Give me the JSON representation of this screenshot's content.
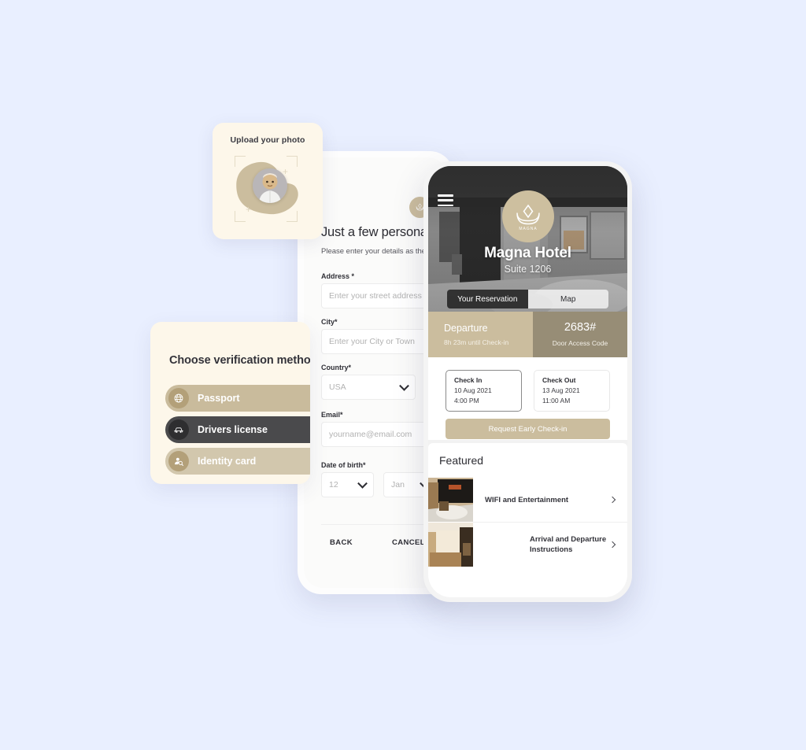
{
  "theme": {
    "page_background": "#e9efff",
    "accent_tan": "#cbbd9e",
    "accent_dark_tan": "#978d76",
    "card_cream": "#fdf7ea",
    "dark": "#4a4a4c"
  },
  "upload_card": {
    "title": "Upload your photo",
    "avatar_icon": "user-photo",
    "frame_icon": "focus-frame-icon"
  },
  "verification_card": {
    "title": "Choose verification method",
    "methods": [
      {
        "label": "Passport",
        "icon": "globe-icon",
        "state": "default"
      },
      {
        "label": "Drivers license",
        "icon": "car-icon",
        "state": "selected"
      },
      {
        "label": "Identity card",
        "icon": "id-person-search-icon",
        "state": "default"
      }
    ]
  },
  "form_phone": {
    "logo_icon": "magna-lotus-logo",
    "heading": "Just a few personal details",
    "subtitle": "Please enter your details as they appear",
    "fields": [
      {
        "label": "Address *",
        "placeholder": "Enter your street address",
        "type": "text"
      },
      {
        "label": "City*",
        "placeholder": "Enter your City or Town",
        "type": "text"
      },
      {
        "label": "Country*",
        "value": "USA",
        "type": "select"
      },
      {
        "label": "Email*",
        "placeholder": "yourname@email.com",
        "type": "text"
      }
    ],
    "dob": {
      "label": "Date of birth*",
      "day": "12",
      "month": "Jan"
    },
    "actions": {
      "back": "BACK",
      "cancel": "CANCEL"
    }
  },
  "hotel_phone": {
    "menu_icon": "hamburger-menu-icon",
    "logo": {
      "icon": "lotus-icon",
      "wordmark": "MAGNA"
    },
    "hotel_name": "Magna Hotel",
    "suite": "Suite 1206",
    "tabs": [
      {
        "label": "Your Reservation",
        "active": true
      },
      {
        "label": "Map",
        "active": false
      }
    ],
    "status_band": {
      "departure_label": "Departure",
      "departure_sub": "8h 23m until Check-in",
      "door_code": "2683#",
      "door_code_label": "Door Access Code"
    },
    "check_in": {
      "title": "Check In",
      "date": "10 Aug 2021",
      "time": "4:00 PM"
    },
    "check_out": {
      "title": "Check Out",
      "date": "13 Aug 2021",
      "time": "11:00 AM"
    },
    "early_checkin_button": "Request Early Check-in",
    "featured": {
      "title": "Featured",
      "items": [
        {
          "label": "WIFI and Entertainment",
          "chevron": "chevron-right-icon"
        },
        {
          "label": "Arrival and Departure Instructions",
          "chevron": "chevron-right-icon"
        }
      ]
    }
  }
}
